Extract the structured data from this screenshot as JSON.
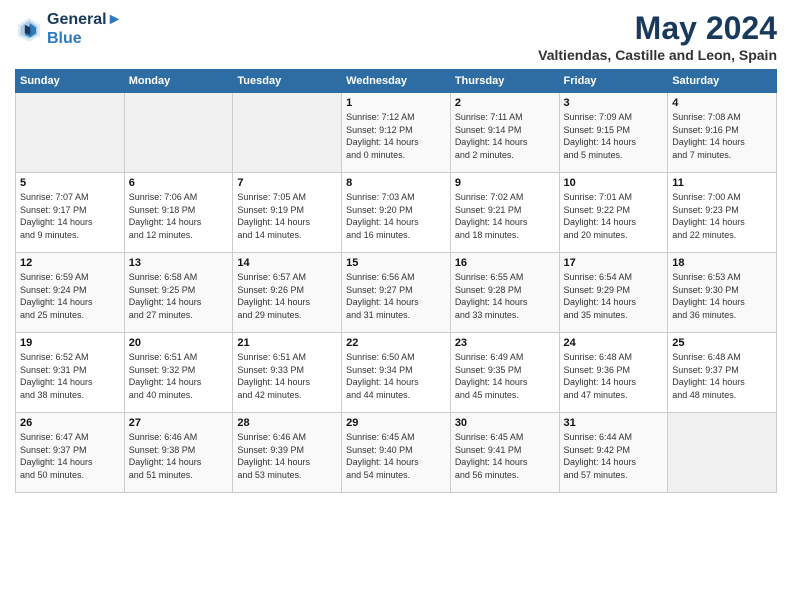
{
  "header": {
    "logo_line1": "General",
    "logo_line2": "Blue",
    "month_title": "May 2024",
    "location": "Valtiendas, Castille and Leon, Spain"
  },
  "days_of_week": [
    "Sunday",
    "Monday",
    "Tuesday",
    "Wednesday",
    "Thursday",
    "Friday",
    "Saturday"
  ],
  "weeks": [
    {
      "cells": [
        {
          "day": null
        },
        {
          "day": null
        },
        {
          "day": null
        },
        {
          "day": 1,
          "sunrise": "7:12 AM",
          "sunset": "9:12 PM",
          "daylight": "14 hours and 0 minutes."
        },
        {
          "day": 2,
          "sunrise": "7:11 AM",
          "sunset": "9:14 PM",
          "daylight": "14 hours and 2 minutes."
        },
        {
          "day": 3,
          "sunrise": "7:09 AM",
          "sunset": "9:15 PM",
          "daylight": "14 hours and 5 minutes."
        },
        {
          "day": 4,
          "sunrise": "7:08 AM",
          "sunset": "9:16 PM",
          "daylight": "14 hours and 7 minutes."
        }
      ]
    },
    {
      "cells": [
        {
          "day": 5,
          "sunrise": "7:07 AM",
          "sunset": "9:17 PM",
          "daylight": "14 hours and 9 minutes."
        },
        {
          "day": 6,
          "sunrise": "7:06 AM",
          "sunset": "9:18 PM",
          "daylight": "14 hours and 12 minutes."
        },
        {
          "day": 7,
          "sunrise": "7:05 AM",
          "sunset": "9:19 PM",
          "daylight": "14 hours and 14 minutes."
        },
        {
          "day": 8,
          "sunrise": "7:03 AM",
          "sunset": "9:20 PM",
          "daylight": "14 hours and 16 minutes."
        },
        {
          "day": 9,
          "sunrise": "7:02 AM",
          "sunset": "9:21 PM",
          "daylight": "14 hours and 18 minutes."
        },
        {
          "day": 10,
          "sunrise": "7:01 AM",
          "sunset": "9:22 PM",
          "daylight": "14 hours and 20 minutes."
        },
        {
          "day": 11,
          "sunrise": "7:00 AM",
          "sunset": "9:23 PM",
          "daylight": "14 hours and 22 minutes."
        }
      ]
    },
    {
      "cells": [
        {
          "day": 12,
          "sunrise": "6:59 AM",
          "sunset": "9:24 PM",
          "daylight": "14 hours and 25 minutes."
        },
        {
          "day": 13,
          "sunrise": "6:58 AM",
          "sunset": "9:25 PM",
          "daylight": "14 hours and 27 minutes."
        },
        {
          "day": 14,
          "sunrise": "6:57 AM",
          "sunset": "9:26 PM",
          "daylight": "14 hours and 29 minutes."
        },
        {
          "day": 15,
          "sunrise": "6:56 AM",
          "sunset": "9:27 PM",
          "daylight": "14 hours and 31 minutes."
        },
        {
          "day": 16,
          "sunrise": "6:55 AM",
          "sunset": "9:28 PM",
          "daylight": "14 hours and 33 minutes."
        },
        {
          "day": 17,
          "sunrise": "6:54 AM",
          "sunset": "9:29 PM",
          "daylight": "14 hours and 35 minutes."
        },
        {
          "day": 18,
          "sunrise": "6:53 AM",
          "sunset": "9:30 PM",
          "daylight": "14 hours and 36 minutes."
        }
      ]
    },
    {
      "cells": [
        {
          "day": 19,
          "sunrise": "6:52 AM",
          "sunset": "9:31 PM",
          "daylight": "14 hours and 38 minutes."
        },
        {
          "day": 20,
          "sunrise": "6:51 AM",
          "sunset": "9:32 PM",
          "daylight": "14 hours and 40 minutes."
        },
        {
          "day": 21,
          "sunrise": "6:51 AM",
          "sunset": "9:33 PM",
          "daylight": "14 hours and 42 minutes."
        },
        {
          "day": 22,
          "sunrise": "6:50 AM",
          "sunset": "9:34 PM",
          "daylight": "14 hours and 44 minutes."
        },
        {
          "day": 23,
          "sunrise": "6:49 AM",
          "sunset": "9:35 PM",
          "daylight": "14 hours and 45 minutes."
        },
        {
          "day": 24,
          "sunrise": "6:48 AM",
          "sunset": "9:36 PM",
          "daylight": "14 hours and 47 minutes."
        },
        {
          "day": 25,
          "sunrise": "6:48 AM",
          "sunset": "9:37 PM",
          "daylight": "14 hours and 48 minutes."
        }
      ]
    },
    {
      "cells": [
        {
          "day": 26,
          "sunrise": "6:47 AM",
          "sunset": "9:37 PM",
          "daylight": "14 hours and 50 minutes."
        },
        {
          "day": 27,
          "sunrise": "6:46 AM",
          "sunset": "9:38 PM",
          "daylight": "14 hours and 51 minutes."
        },
        {
          "day": 28,
          "sunrise": "6:46 AM",
          "sunset": "9:39 PM",
          "daylight": "14 hours and 53 minutes."
        },
        {
          "day": 29,
          "sunrise": "6:45 AM",
          "sunset": "9:40 PM",
          "daylight": "14 hours and 54 minutes."
        },
        {
          "day": 30,
          "sunrise": "6:45 AM",
          "sunset": "9:41 PM",
          "daylight": "14 hours and 56 minutes."
        },
        {
          "day": 31,
          "sunrise": "6:44 AM",
          "sunset": "9:42 PM",
          "daylight": "14 hours and 57 minutes."
        },
        {
          "day": null
        }
      ]
    }
  ],
  "labels": {
    "sunrise": "Sunrise:",
    "sunset": "Sunset:",
    "daylight": "Daylight hours"
  }
}
